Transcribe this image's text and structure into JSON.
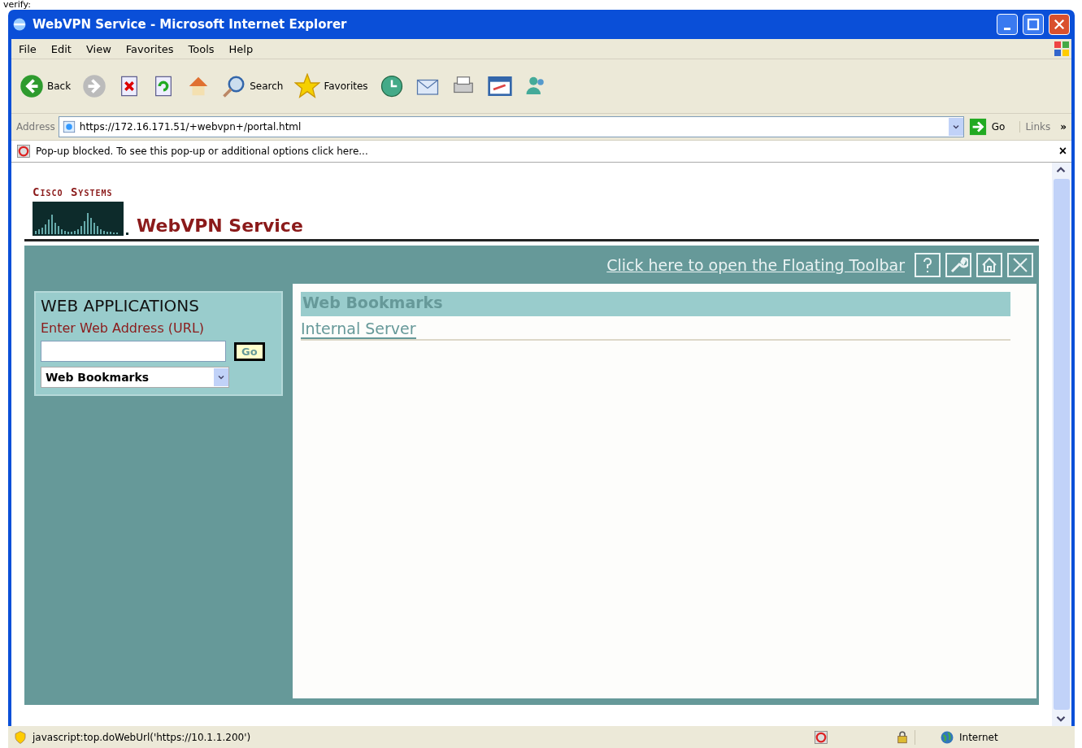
{
  "page_text": "verify:",
  "window": {
    "title": "WebVPN Service - Microsoft Internet Explorer"
  },
  "menu": [
    "File",
    "Edit",
    "View",
    "Favorites",
    "Tools",
    "Help"
  ],
  "toolbar": [
    {
      "kind": "back",
      "label": "Back"
    },
    {
      "kind": "forward"
    },
    {
      "kind": "stop"
    },
    {
      "kind": "refresh"
    },
    {
      "kind": "home"
    },
    {
      "kind": "search",
      "label": "Search"
    },
    {
      "kind": "favorites",
      "label": "Favorites"
    },
    {
      "kind": "history"
    },
    {
      "kind": "mail"
    },
    {
      "kind": "print"
    },
    {
      "kind": "edit"
    },
    {
      "kind": "messenger"
    }
  ],
  "address": {
    "label": "Address",
    "value": "https://172.16.171.51/+webvpn+/portal.html",
    "go": "Go",
    "links": "Links",
    "more": "»"
  },
  "popup_bar": {
    "message": "Pop-up blocked. To see this pop-up or additional options click here...",
    "close": "×"
  },
  "page": {
    "logo": "Cisco Systems",
    "heading": "WebVPN Service",
    "floating_toolbar_link": "Click here to open the Floating Toolbar",
    "tool_buttons": [
      {
        "kind": "help"
      },
      {
        "kind": "settings"
      },
      {
        "kind": "home"
      },
      {
        "kind": "close"
      }
    ],
    "web_applications": {
      "title": "WEB APPLICATIONS",
      "url_label": "Enter Web Address (URL)",
      "go": "Go",
      "select": "Web Bookmarks"
    },
    "bookmarks": {
      "title": "Web Bookmarks",
      "items": [
        "Internal Server"
      ]
    }
  },
  "status_bar": {
    "text": "javascript:top.doWebUrl('https://10.1.1.200')",
    "zone": "Internet"
  }
}
